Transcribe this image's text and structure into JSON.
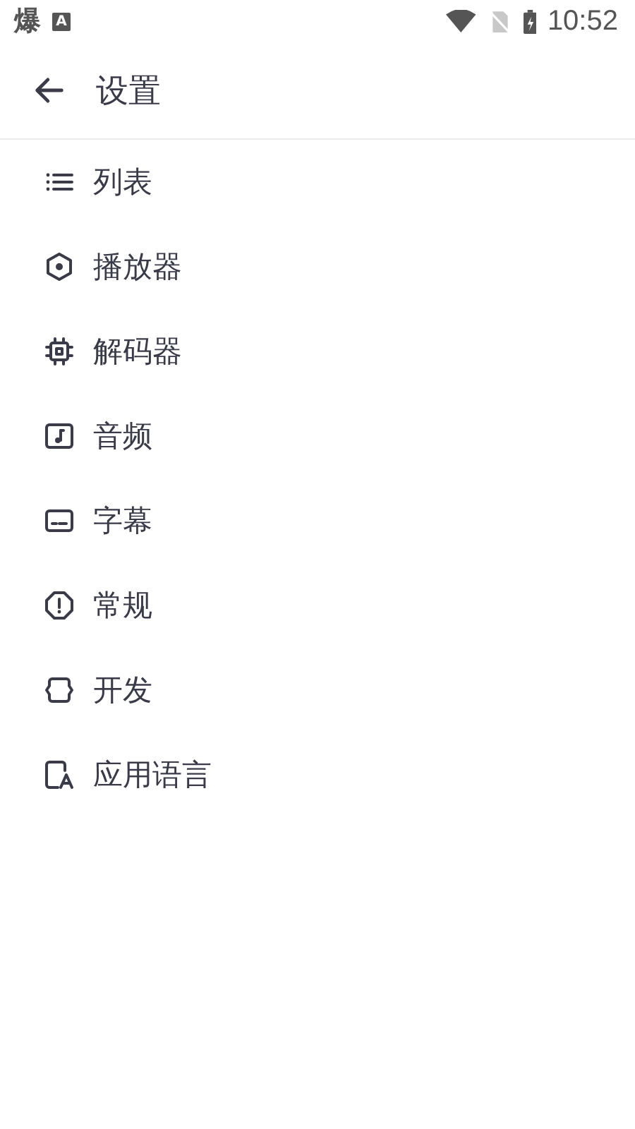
{
  "status_bar": {
    "notification_glyph": "爆",
    "notification_badge": "A",
    "time": "10:52"
  },
  "toolbar": {
    "title": "设置"
  },
  "items": [
    {
      "label": "列表"
    },
    {
      "label": "播放器"
    },
    {
      "label": "解码器"
    },
    {
      "label": "音频"
    },
    {
      "label": "字幕"
    },
    {
      "label": "常规"
    },
    {
      "label": "开发"
    },
    {
      "label": "应用语言"
    }
  ]
}
